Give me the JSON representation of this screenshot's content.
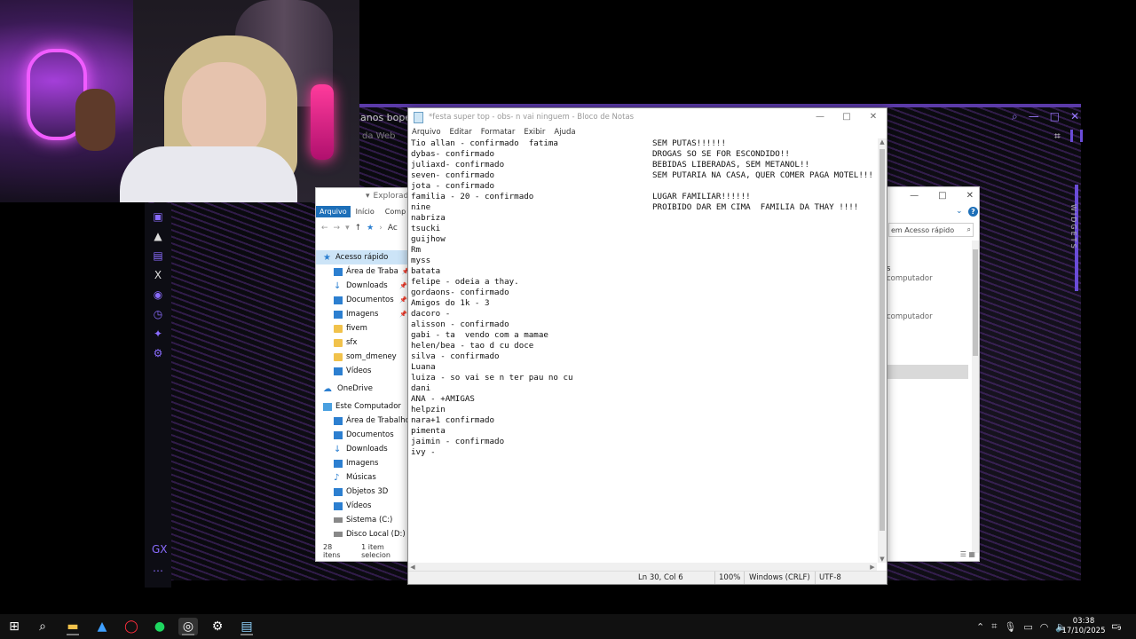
{
  "opera_gx": {
    "tab_title": "anos bope - F",
    "tab_subtitle": "da Web",
    "widgets_label": "WIDGETS",
    "accent_color": "#6a4cd8"
  },
  "explorer_left": {
    "title": "Explorador",
    "ribbon": {
      "file_tab": "Arquivo",
      "home_tab": "Início",
      "share_tab": "Comp"
    },
    "breadcrumb": "Ac",
    "tree": [
      {
        "label": "Acesso rápido",
        "level": 0,
        "icon": "star-icon",
        "selected": true
      },
      {
        "label": "Área de Traba",
        "level": 1,
        "icon": "desktop-icon",
        "pinned": true
      },
      {
        "label": "Downloads",
        "level": 1,
        "icon": "download-icon",
        "pinned": true
      },
      {
        "label": "Documentos",
        "level": 1,
        "icon": "documents-icon",
        "pinned": true
      },
      {
        "label": "Imagens",
        "level": 1,
        "icon": "images-icon",
        "pinned": true
      },
      {
        "label": "fivem",
        "level": 1,
        "icon": "folder-icon"
      },
      {
        "label": "sfx",
        "level": 1,
        "icon": "folder-icon"
      },
      {
        "label": "som_dmeney",
        "level": 1,
        "icon": "folder-icon"
      },
      {
        "label": "Vídeos",
        "level": 1,
        "icon": "videos-icon"
      },
      {
        "label": "OneDrive",
        "level": 0,
        "icon": "cloud-icon"
      },
      {
        "label": "Este Computador",
        "level": 0,
        "icon": "computer-icon"
      },
      {
        "label": "Área de Trabalho",
        "level": 1,
        "icon": "desktop-icon"
      },
      {
        "label": "Documentos",
        "level": 1,
        "icon": "documents-icon"
      },
      {
        "label": "Downloads",
        "level": 1,
        "icon": "download-icon"
      },
      {
        "label": "Imagens",
        "level": 1,
        "icon": "images-icon"
      },
      {
        "label": "Músicas",
        "level": 1,
        "icon": "music-icon"
      },
      {
        "label": "Objetos 3D",
        "level": 1,
        "icon": "cube-icon"
      },
      {
        "label": "Vídeos",
        "level": 1,
        "icon": "videos-icon"
      },
      {
        "label": "Sistema (C:)",
        "level": 1,
        "icon": "drive-icon"
      },
      {
        "label": "Disco Local (D:)",
        "level": 1,
        "icon": "drive-icon"
      }
    ],
    "status_count": "28 itens",
    "status_selected": "1 item selecion"
  },
  "explorer_right": {
    "search_placeholder": "em Acesso rápido",
    "items": [
      "s",
      "computador",
      "computador"
    ]
  },
  "notepad": {
    "title": "*festa super top - obs- n vai ninguem - Bloco de Notas",
    "menu": [
      "Arquivo",
      "Editar",
      "Formatar",
      "Exibir",
      "Ajuda"
    ],
    "left_lines": [
      "Tio allan - confirmado  fatima",
      "dybas- confirmado",
      "juliaxd- confirmado",
      "seven- confirmado",
      "jota - confirmado",
      "familia - 20 - confirmado",
      "nine",
      "nabriza",
      "tsucki",
      "guijhow",
      "Rm",
      "myss",
      "batata",
      "felipe - odeia a thay.",
      "gordaons- confirmado",
      "Amigos do 1k - 3",
      "dacoro -",
      "alisson - confirmado",
      "gabi - ta  vendo com a mamae",
      "helen/bea - tao d cu doce",
      "silva - confirmado",
      "Luana",
      "luiza - so vai se n ter pau no cu",
      "dani",
      "ANA - +AMIGAS",
      "helpzin",
      "nara+1 confirmado",
      "pimenta",
      "jaimin - confirmado",
      "ivy -"
    ],
    "right_lines": [
      "SEM PUTAS!!!!!!",
      "DROGAS SO SE FOR ESCONDIDO!!",
      "BEBIDAS LIBERADAS, SEM METANOL!!",
      "SEM PUTARIA NA CASA, QUER COMER PAGA MOTEL!!!",
      "",
      "LUGAR FAMILIAR!!!!!!",
      "PROIBIDO DAR EM CIMA  FAMILIA DA THAY !!!!"
    ],
    "status": {
      "position": "Ln 30, Col 6",
      "zoom": "100%",
      "line_ending": "Windows (CRLF)",
      "encoding": "UTF-8"
    }
  },
  "taskbar": {
    "apps": [
      "windows-start-icon",
      "search-icon",
      "file-explorer-icon",
      "aura-app-icon",
      "opera-gx-icon",
      "spotify-icon",
      "obs-icon",
      "steelseries-icon",
      "notepad-icon"
    ],
    "time": "03:38",
    "date": "17/10/2025",
    "notification_count": "9"
  }
}
